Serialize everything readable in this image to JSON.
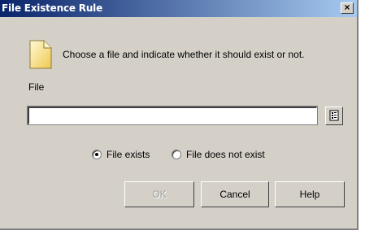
{
  "dialog": {
    "title": "File Existence Rule",
    "close_label": "×",
    "instruction": "Choose a file and indicate whether it should exist or not.",
    "file_label": "File",
    "file_value": "",
    "radio_exists": "File exists",
    "radio_not_exists": "File does not exist",
    "selected_option": "File exists",
    "ok_label": "OK",
    "cancel_label": "Cancel",
    "help_label": "Help"
  },
  "colors": {
    "titlebar_start": "#0a246a",
    "titlebar_end": "#a6caf0",
    "face": "#d4d0c8"
  },
  "icons": [
    "document-icon",
    "browse-icon",
    "close-icon"
  ]
}
